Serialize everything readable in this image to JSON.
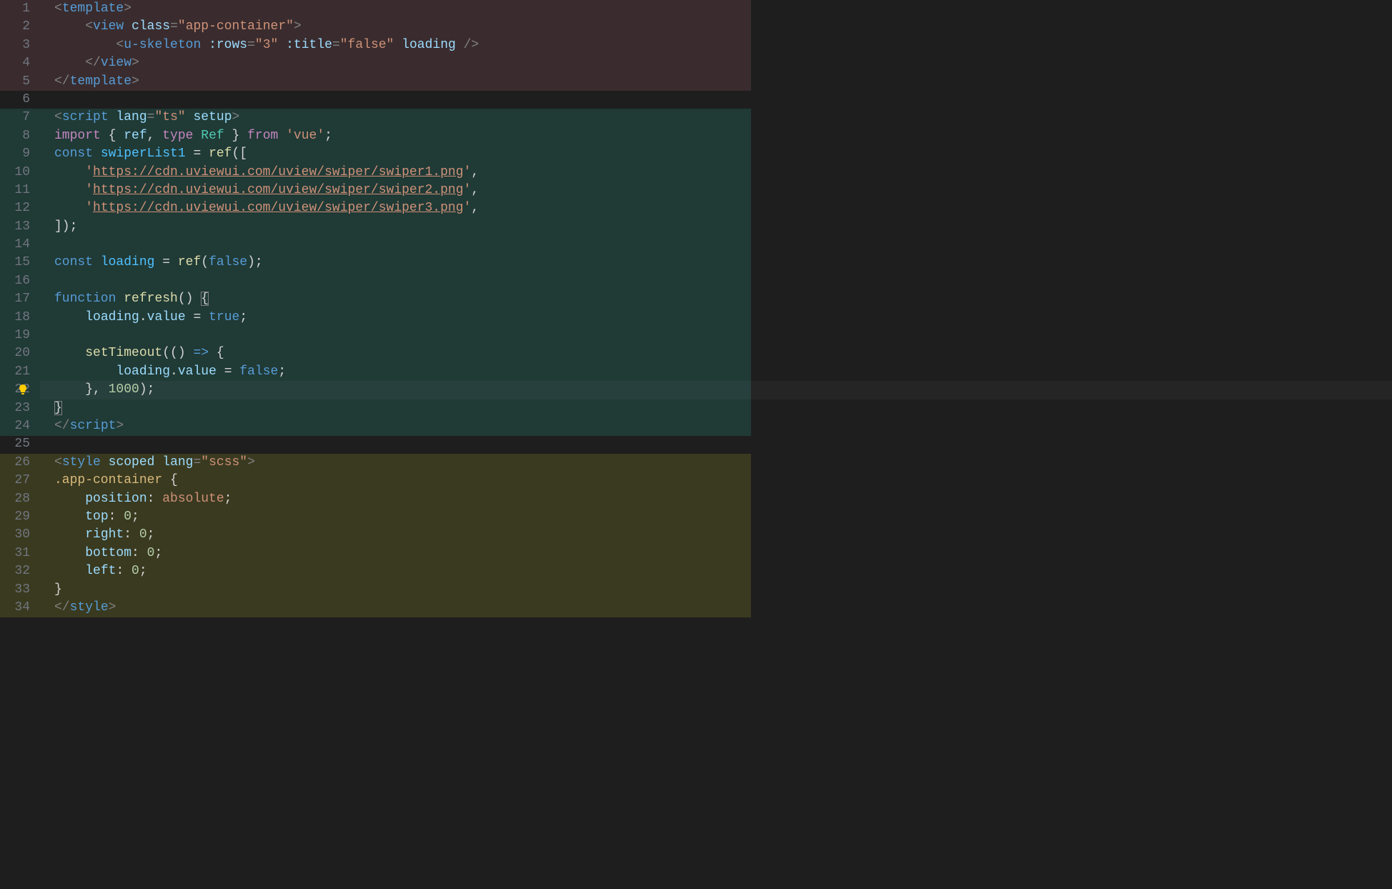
{
  "lineCount": 34,
  "activeLine": 22,
  "regions": [
    {
      "class": "bg-template",
      "start": 1,
      "end": 5
    },
    {
      "class": "bg-script",
      "start": 7,
      "end": 24
    },
    {
      "class": "bg-style",
      "start": 26,
      "end": 34
    }
  ],
  "lines": {
    "1": [
      {
        "c": "t-punc",
        "t": "<"
      },
      {
        "c": "t-tag",
        "t": "template"
      },
      {
        "c": "t-punc",
        "t": ">"
      }
    ],
    "2": [
      {
        "c": "",
        "t": "    "
      },
      {
        "c": "t-punc",
        "t": "<"
      },
      {
        "c": "t-tag",
        "t": "view"
      },
      {
        "c": "",
        "t": " "
      },
      {
        "c": "t-attr",
        "t": "class"
      },
      {
        "c": "t-punc",
        "t": "="
      },
      {
        "c": "t-str",
        "t": "\"app-container\""
      },
      {
        "c": "t-punc",
        "t": ">"
      }
    ],
    "3": [
      {
        "c": "",
        "t": "        "
      },
      {
        "c": "t-punc",
        "t": "<"
      },
      {
        "c": "t-tag",
        "t": "u-skeleton"
      },
      {
        "c": "",
        "t": " "
      },
      {
        "c": "t-attr",
        "t": ":rows"
      },
      {
        "c": "t-punc",
        "t": "="
      },
      {
        "c": "t-str",
        "t": "\"3\""
      },
      {
        "c": "",
        "t": " "
      },
      {
        "c": "t-attr",
        "t": ":title"
      },
      {
        "c": "t-punc",
        "t": "="
      },
      {
        "c": "t-str",
        "t": "\"false\""
      },
      {
        "c": "",
        "t": " "
      },
      {
        "c": "t-attr",
        "t": "loading"
      },
      {
        "c": "",
        "t": " "
      },
      {
        "c": "t-punc",
        "t": "/>"
      }
    ],
    "4": [
      {
        "c": "",
        "t": "    "
      },
      {
        "c": "t-punc",
        "t": "</"
      },
      {
        "c": "t-tag",
        "t": "view"
      },
      {
        "c": "t-punc",
        "t": ">"
      }
    ],
    "5": [
      {
        "c": "t-punc",
        "t": "</"
      },
      {
        "c": "t-tag",
        "t": "template"
      },
      {
        "c": "t-punc",
        "t": ">"
      }
    ],
    "6": [],
    "7": [
      {
        "c": "t-punc",
        "t": "<"
      },
      {
        "c": "t-tag",
        "t": "script"
      },
      {
        "c": "",
        "t": " "
      },
      {
        "c": "t-attr",
        "t": "lang"
      },
      {
        "c": "t-punc",
        "t": "="
      },
      {
        "c": "t-str",
        "t": "\"ts\""
      },
      {
        "c": "",
        "t": " "
      },
      {
        "c": "t-attr",
        "t": "setup"
      },
      {
        "c": "t-punc",
        "t": ">"
      }
    ],
    "8": [
      {
        "c": "t-kw",
        "t": "import"
      },
      {
        "c": "",
        "t": " "
      },
      {
        "c": "t-op",
        "t": "{ "
      },
      {
        "c": "t-var",
        "t": "ref"
      },
      {
        "c": "t-op",
        "t": ", "
      },
      {
        "c": "t-kw",
        "t": "type"
      },
      {
        "c": "",
        "t": " "
      },
      {
        "c": "t-type",
        "t": "Ref"
      },
      {
        "c": "t-op",
        "t": " } "
      },
      {
        "c": "t-kw",
        "t": "from"
      },
      {
        "c": "",
        "t": " "
      },
      {
        "c": "t-str",
        "t": "'vue'"
      },
      {
        "c": "t-op",
        "t": ";"
      }
    ],
    "9": [
      {
        "c": "t-kw2",
        "t": "const"
      },
      {
        "c": "",
        "t": " "
      },
      {
        "c": "t-varro",
        "t": "swiperList1"
      },
      {
        "c": "",
        "t": " "
      },
      {
        "c": "t-op",
        "t": "= "
      },
      {
        "c": "t-fn",
        "t": "ref"
      },
      {
        "c": "t-op",
        "t": "(["
      }
    ],
    "10": [
      {
        "c": "",
        "t": "    "
      },
      {
        "c": "t-str",
        "t": "'"
      },
      {
        "c": "t-strlnk",
        "t": "https://cdn.uviewui.com/uview/swiper/swiper1.png"
      },
      {
        "c": "t-str",
        "t": "'"
      },
      {
        "c": "t-op",
        "t": ","
      }
    ],
    "11": [
      {
        "c": "",
        "t": "    "
      },
      {
        "c": "t-str",
        "t": "'"
      },
      {
        "c": "t-strlnk",
        "t": "https://cdn.uviewui.com/uview/swiper/swiper2.png"
      },
      {
        "c": "t-str",
        "t": "'"
      },
      {
        "c": "t-op",
        "t": ","
      }
    ],
    "12": [
      {
        "c": "",
        "t": "    "
      },
      {
        "c": "t-str",
        "t": "'"
      },
      {
        "c": "t-strlnk",
        "t": "https://cdn.uviewui.com/uview/swiper/swiper3.png"
      },
      {
        "c": "t-str",
        "t": "'"
      },
      {
        "c": "t-op",
        "t": ","
      }
    ],
    "13": [
      {
        "c": "t-op",
        "t": "]);"
      }
    ],
    "14": [],
    "15": [
      {
        "c": "t-kw2",
        "t": "const"
      },
      {
        "c": "",
        "t": " "
      },
      {
        "c": "t-varro",
        "t": "loading"
      },
      {
        "c": "",
        "t": " "
      },
      {
        "c": "t-op",
        "t": "= "
      },
      {
        "c": "t-fn",
        "t": "ref"
      },
      {
        "c": "t-op",
        "t": "("
      },
      {
        "c": "t-const",
        "t": "false"
      },
      {
        "c": "t-op",
        "t": ");"
      }
    ],
    "16": [],
    "17": [
      {
        "c": "t-kw2",
        "t": "function"
      },
      {
        "c": "",
        "t": " "
      },
      {
        "c": "t-fn",
        "t": "refresh"
      },
      {
        "c": "t-op",
        "t": "() "
      },
      {
        "c": "t-op t-bracket-match",
        "t": "{"
      }
    ],
    "18": [
      {
        "c": "",
        "t": "    "
      },
      {
        "c": "t-var",
        "t": "loading"
      },
      {
        "c": "t-op",
        "t": "."
      },
      {
        "c": "t-prop",
        "t": "value"
      },
      {
        "c": "",
        "t": " "
      },
      {
        "c": "t-op",
        "t": "= "
      },
      {
        "c": "t-const",
        "t": "true"
      },
      {
        "c": "t-op",
        "t": ";"
      }
    ],
    "19": [],
    "20": [
      {
        "c": "",
        "t": "    "
      },
      {
        "c": "t-fn",
        "t": "setTimeout"
      },
      {
        "c": "t-op",
        "t": "(() "
      },
      {
        "c": "t-kw2",
        "t": "=>"
      },
      {
        "c": "t-op",
        "t": " {"
      }
    ],
    "21": [
      {
        "c": "",
        "t": "        "
      },
      {
        "c": "t-var",
        "t": "loading"
      },
      {
        "c": "t-op",
        "t": "."
      },
      {
        "c": "t-prop",
        "t": "value"
      },
      {
        "c": "",
        "t": " "
      },
      {
        "c": "t-op",
        "t": "= "
      },
      {
        "c": "t-const",
        "t": "false"
      },
      {
        "c": "t-op",
        "t": ";"
      }
    ],
    "22": [
      {
        "c": "",
        "t": "    "
      },
      {
        "c": "t-op",
        "t": "}, "
      },
      {
        "c": "t-num",
        "t": "1000"
      },
      {
        "c": "t-op",
        "t": ");"
      }
    ],
    "23": [
      {
        "c": "t-op t-bracket-match",
        "t": "}"
      }
    ],
    "24": [
      {
        "c": "t-punc",
        "t": "</"
      },
      {
        "c": "t-tag",
        "t": "script"
      },
      {
        "c": "t-punc",
        "t": ">"
      }
    ],
    "25": [],
    "26": [
      {
        "c": "t-punc",
        "t": "<"
      },
      {
        "c": "t-tag",
        "t": "style"
      },
      {
        "c": "",
        "t": " "
      },
      {
        "c": "t-attr",
        "t": "scoped"
      },
      {
        "c": "",
        "t": " "
      },
      {
        "c": "t-attr",
        "t": "lang"
      },
      {
        "c": "t-punc",
        "t": "="
      },
      {
        "c": "t-str",
        "t": "\"scss\""
      },
      {
        "c": "t-punc",
        "t": ">"
      }
    ],
    "27": [
      {
        "c": "t-csssel",
        "t": ".app-container"
      },
      {
        "c": "",
        "t": " "
      },
      {
        "c": "t-op",
        "t": "{"
      }
    ],
    "28": [
      {
        "c": "",
        "t": "    "
      },
      {
        "c": "t-cssprop",
        "t": "position"
      },
      {
        "c": "t-op",
        "t": ": "
      },
      {
        "c": "t-str",
        "t": "absolute"
      },
      {
        "c": "t-op",
        "t": ";"
      }
    ],
    "29": [
      {
        "c": "",
        "t": "    "
      },
      {
        "c": "t-cssprop",
        "t": "top"
      },
      {
        "c": "t-op",
        "t": ": "
      },
      {
        "c": "t-num",
        "t": "0"
      },
      {
        "c": "t-op",
        "t": ";"
      }
    ],
    "30": [
      {
        "c": "",
        "t": "    "
      },
      {
        "c": "t-cssprop",
        "t": "right"
      },
      {
        "c": "t-op",
        "t": ": "
      },
      {
        "c": "t-num",
        "t": "0"
      },
      {
        "c": "t-op",
        "t": ";"
      }
    ],
    "31": [
      {
        "c": "",
        "t": "    "
      },
      {
        "c": "t-cssprop",
        "t": "bottom"
      },
      {
        "c": "t-op",
        "t": ": "
      },
      {
        "c": "t-num",
        "t": "0"
      },
      {
        "c": "t-op",
        "t": ";"
      }
    ],
    "32": [
      {
        "c": "",
        "t": "    "
      },
      {
        "c": "t-cssprop",
        "t": "left"
      },
      {
        "c": "t-op",
        "t": ": "
      },
      {
        "c": "t-num",
        "t": "0"
      },
      {
        "c": "t-op",
        "t": ";"
      }
    ],
    "33": [
      {
        "c": "t-op",
        "t": "}"
      }
    ],
    "34": [
      {
        "c": "t-punc",
        "t": "</"
      },
      {
        "c": "t-tag",
        "t": "style"
      },
      {
        "c": "t-punc",
        "t": ">"
      }
    ]
  }
}
